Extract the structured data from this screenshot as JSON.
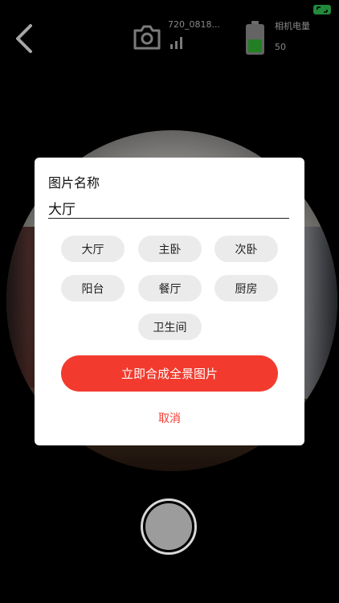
{
  "status_bar": {
    "indicator_color": "#37d35b"
  },
  "top_bar": {
    "back_icon": "chevron-left-icon",
    "camera_icon": "camera-icon",
    "device_name": "720_0818...",
    "signal_icon": "signal-bars-icon",
    "battery_icon": "battery-icon",
    "battery_label": "相机电量",
    "battery_value": "50",
    "battery_color": "#37c437"
  },
  "dialog": {
    "title": "图片名称",
    "name_value": "大厅",
    "rooms": [
      "大厅",
      "主卧",
      "次卧",
      "阳台",
      "餐厅",
      "厨房",
      "卫生间"
    ],
    "confirm_label": "立即合成全景图片",
    "cancel_label": "取消",
    "accent_color": "#f23b2e"
  },
  "shutter": {
    "icon": "shutter-button-icon"
  }
}
